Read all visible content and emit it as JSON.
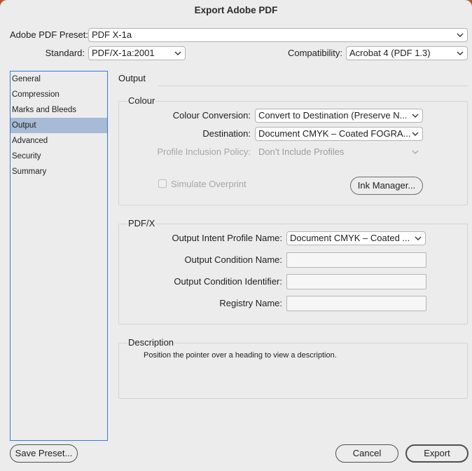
{
  "window": {
    "title": "Export Adobe PDF"
  },
  "preset": {
    "label": "Adobe PDF Preset:",
    "value": "PDF X-1a"
  },
  "standard": {
    "label": "Standard:",
    "value": "PDF/X-1a:2001"
  },
  "compatibility": {
    "label": "Compatibility:",
    "value": "Acrobat 4 (PDF 1.3)"
  },
  "sidebar": {
    "items": [
      {
        "label": "General"
      },
      {
        "label": "Compression"
      },
      {
        "label": "Marks and Bleeds"
      },
      {
        "label": "Output",
        "selected": true
      },
      {
        "label": "Advanced"
      },
      {
        "label": "Security"
      },
      {
        "label": "Summary"
      }
    ]
  },
  "main": {
    "section_title": "Output",
    "colour": {
      "legend": "Colour",
      "conversion_label": "Colour Conversion:",
      "conversion_value": "Convert to Destination (Preserve N...",
      "destination_label": "Destination:",
      "destination_value": "Document CMYK – Coated FOGRA...",
      "profile_policy_label": "Profile Inclusion Policy:",
      "profile_policy_value": "Don't Include Profiles",
      "simulate_overprint_label": "Simulate Overprint",
      "simulate_overprint_checked": false,
      "ink_manager_label": "Ink Manager..."
    },
    "pdfx": {
      "legend": "PDF/X",
      "intent_profile_label": "Output Intent Profile Name:",
      "intent_profile_value": "Document CMYK – Coated ...",
      "condition_name_label": "Output Condition Name:",
      "condition_name_value": "",
      "condition_id_label": "Output Condition Identifier:",
      "condition_id_value": "",
      "registry_label": "Registry Name:",
      "registry_value": ""
    },
    "description": {
      "legend": "Description",
      "text": "Position the pointer over a heading to view a description."
    }
  },
  "footer": {
    "save_preset_label": "Save Preset...",
    "cancel_label": "Cancel",
    "export_label": "Export"
  },
  "colors": {
    "selection": "#a7bbd6",
    "focus_border": "#3a78d8",
    "window_bg": "#ececec",
    "desktop_bg": "#c0502a"
  }
}
